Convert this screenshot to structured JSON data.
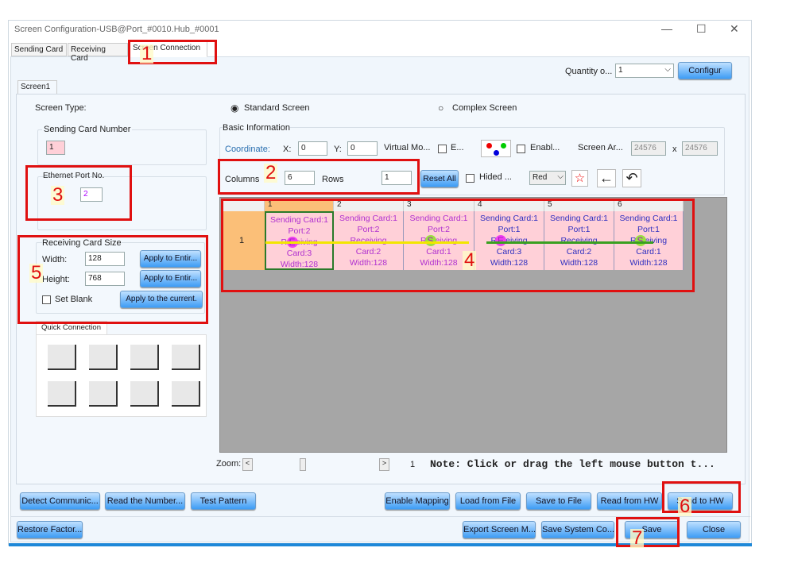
{
  "window": {
    "title": "Screen Configuration-USB@Port_#0010.Hub_#0001",
    "min": "—",
    "max": "☐",
    "close": "✕"
  },
  "tabs": [
    "Sending Card",
    "Receiving Card",
    "Screen Connection"
  ],
  "quantity": {
    "label": "Quantity o...",
    "value": "1",
    "button": "Configur"
  },
  "screen_tab": "Screen1",
  "screen_type": {
    "label": "Screen Type:",
    "standard": "Standard Screen",
    "complex": "Complex Screen"
  },
  "sending_card_number": {
    "label": "Sending Card Number",
    "value": "1"
  },
  "ethernet_port": {
    "label": "Ethernet Port No.",
    "value": "2"
  },
  "receiving_card_size": {
    "label": "Receiving Card Size",
    "width_label": "Width:",
    "width": "128",
    "height_label": "Height:",
    "height": "768",
    "apply_entire": "Apply to Entir...",
    "apply_entire2": "Apply to Entir...",
    "set_blank": "Set Blank",
    "apply_current": "Apply to the current."
  },
  "quick_connection": {
    "label": "Quick Connection"
  },
  "basic_info": {
    "label": "Basic Information",
    "coordinate": "Coordinate:",
    "x_label": "X:",
    "x": "0",
    "y_label": "Y:",
    "y": "0",
    "virtual": "Virtual Mo...",
    "e": "E...",
    "enable": "Enabl...",
    "screen_area": "Screen Ar...",
    "area_w": "24576",
    "x_sep": "x",
    "area_h": "24576",
    "columns_label": "Columns",
    "columns": "6",
    "rows_label": "Rows",
    "rows": "1",
    "reset_all": "Reset All",
    "hided": "Hided ...",
    "color": "Red"
  },
  "grid": {
    "columns": [
      "1",
      "2",
      "3",
      "4",
      "5",
      "6"
    ],
    "row": "1",
    "cells": [
      {
        "l1": "Sending Card:1",
        "l2": "Port:2",
        "l3": "Receiving",
        "l4": "Card:3",
        "l5": "Width:128",
        "mark": "E"
      },
      {
        "l1": "Sending Card:1",
        "l2": "Port:2",
        "l3": "Receiving",
        "l4": "Card:2",
        "l5": "Width:128",
        "mark": ""
      },
      {
        "l1": "Sending Card:1",
        "l2": "Port:2",
        "l3": "Receiving",
        "l4": "Card:1",
        "l5": "Width:128",
        "mark": "S"
      },
      {
        "l1": "Sending Card:1",
        "l2": "Port:1",
        "l3": "Receiving",
        "l4": "Card:3",
        "l5": "Width:128",
        "mark": "E"
      },
      {
        "l1": "Sending Card:1",
        "l2": "Port:1",
        "l3": "Receiving",
        "l4": "Card:2",
        "l5": "Width:128",
        "mark": ""
      },
      {
        "l1": "Sending Card:1",
        "l2": "Port:1",
        "l3": "Receiving",
        "l4": "Card:1",
        "l5": "Width:128",
        "mark": "S"
      }
    ]
  },
  "zoom": {
    "label": "Zoom:",
    "left": "<",
    "right": ">",
    "value": "1",
    "note": "Note: Click or drag the left mouse button t..."
  },
  "buttons_row1": [
    "Detect Communic...",
    "Read the Number...",
    "Test Pattern",
    "Enable Mapping",
    "Load from File",
    "Save to File",
    "Read from HW",
    "Send to HW"
  ],
  "buttons_row2": [
    "Restore Factor...",
    "Export Screen M...",
    "Save System Co...",
    "Save",
    "Close"
  ],
  "annotations": [
    "1",
    "2",
    "3",
    "4",
    "5",
    "6",
    "7"
  ]
}
